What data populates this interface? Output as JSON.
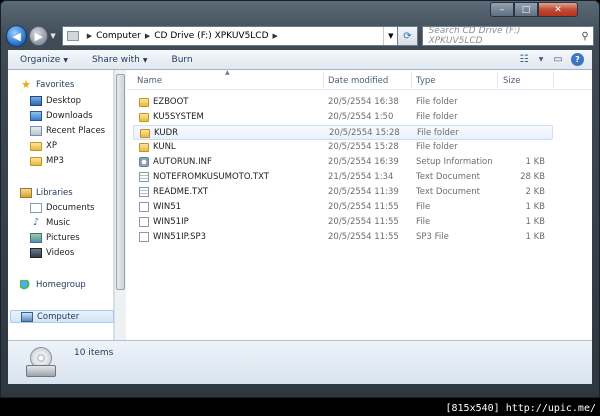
{
  "window": {
    "minimize_glyph": "–",
    "maximize_glyph": "□",
    "close_glyph": "✕"
  },
  "address_bar": {
    "crumbs": [
      "Computer",
      "CD Drive (F:) XPKUV5LCD"
    ],
    "search_placeholder": "Search CD Drive (F:) XPKUV5LCD"
  },
  "toolbar": {
    "organize": "Organize",
    "share_with": "Share with",
    "burn": "Burn"
  },
  "nav": {
    "favorites": "Favorites",
    "favorites_items": [
      "Desktop",
      "Downloads",
      "Recent Places",
      "XP",
      "MP3"
    ],
    "libraries": "Libraries",
    "libraries_items": [
      "Documents",
      "Music",
      "Pictures",
      "Videos"
    ],
    "homegroup": "Homegroup",
    "computer": "Computer"
  },
  "columns": {
    "name": "Name",
    "date_modified": "Date modified",
    "type": "Type",
    "size": "Size"
  },
  "files": [
    {
      "name": "EZBOOT",
      "date": "20/5/2554 16:38",
      "type": "File folder",
      "size": "",
      "icon": "folder"
    },
    {
      "name": "KU5SYSTEM",
      "date": "20/5/2554 1:50",
      "type": "File folder",
      "size": "",
      "icon": "folder"
    },
    {
      "name": "KUDR",
      "date": "20/5/2554 15:28",
      "type": "File folder",
      "size": "",
      "icon": "folder"
    },
    {
      "name": "KUNL",
      "date": "20/5/2554 15:28",
      "type": "File folder",
      "size": "",
      "icon": "folder"
    },
    {
      "name": "AUTORUN.INF",
      "date": "20/5/2554 16:39",
      "type": "Setup Information",
      "size": "1 KB",
      "icon": "setup"
    },
    {
      "name": "NOTEFROMKUSUMOTO.TXT",
      "date": "21/5/2554 1:34",
      "type": "Text Document",
      "size": "28 KB",
      "icon": "text"
    },
    {
      "name": "README.TXT",
      "date": "20/5/2554 11:39",
      "type": "Text Document",
      "size": "2 KB",
      "icon": "text"
    },
    {
      "name": "WIN51",
      "date": "20/5/2554 11:55",
      "type": "File",
      "size": "1 KB",
      "icon": "file"
    },
    {
      "name": "WIN51IP",
      "date": "20/5/2554 11:55",
      "type": "File",
      "size": "1 KB",
      "icon": "file"
    },
    {
      "name": "WIN51IP.SP3",
      "date": "20/5/2554 11:55",
      "type": "SP3 File",
      "size": "1 KB",
      "icon": "file"
    }
  ],
  "details": {
    "item_count": "10 items"
  },
  "watermark": "[815x540] http://upic.me/"
}
